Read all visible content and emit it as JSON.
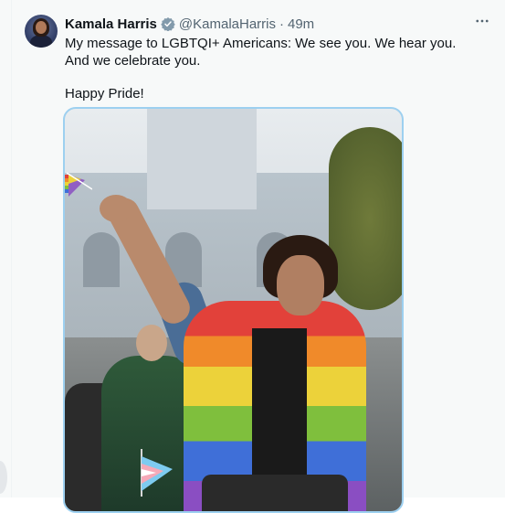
{
  "tweet": {
    "author": {
      "display_name": "Kamala Harris",
      "handle": "@KamalaHarris",
      "verified": true
    },
    "separator": "·",
    "time": "49m",
    "text_line1": "My message to LGBTQI+ Americans: We see you. We hear you. And we celebrate you.",
    "text_line2": "Happy Pride!",
    "more_icon": "more-horizontal-icon",
    "colors": {
      "verified_badge": "#829aab",
      "photo_border": "#9dd0f0",
      "muted_text": "#536471"
    }
  }
}
